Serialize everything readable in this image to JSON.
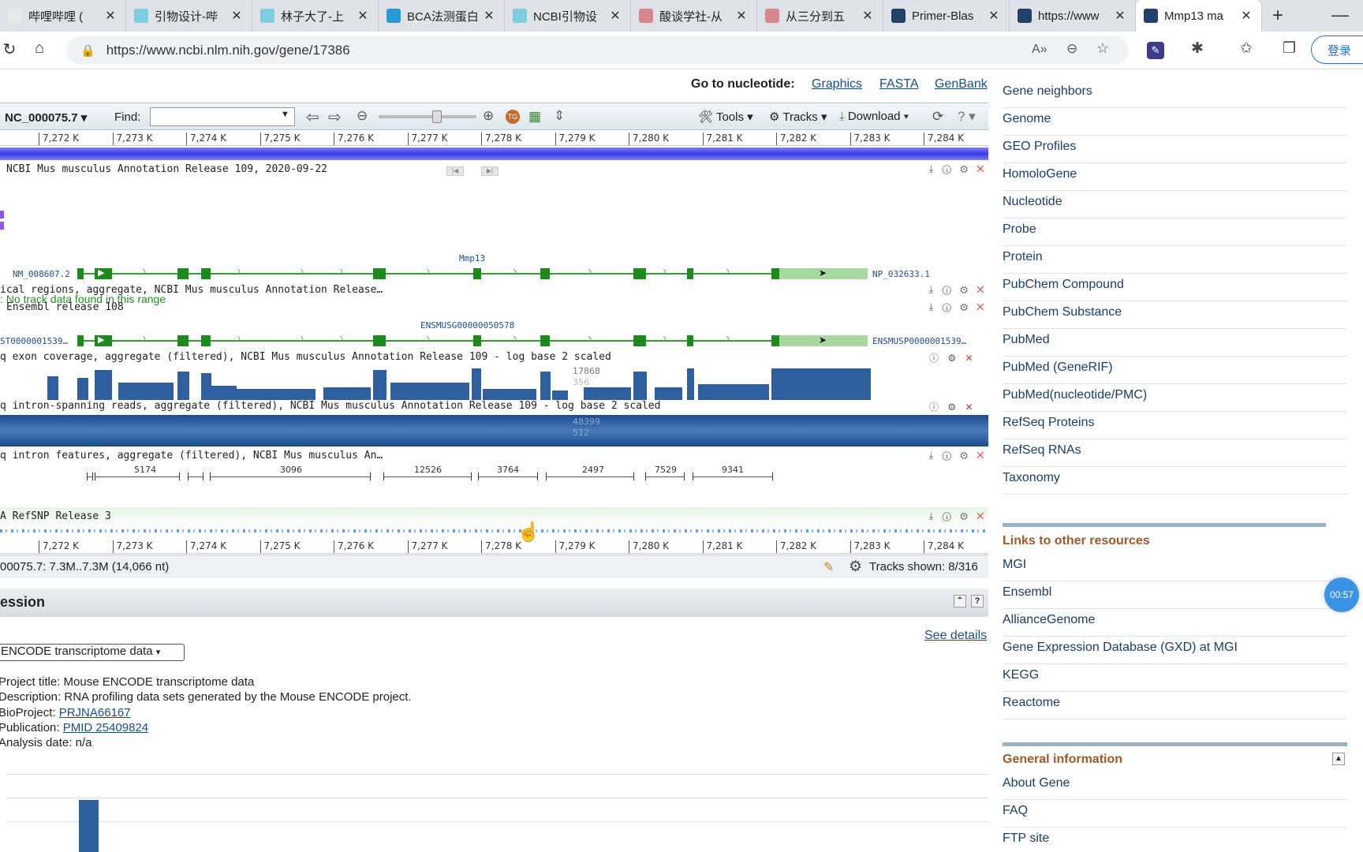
{
  "browser": {
    "tabs": [
      {
        "title": "哔哩哔哩 (",
        "color": "#e8e8e8"
      },
      {
        "title": "引物设计-哔",
        "color": "#7fcde0"
      },
      {
        "title": "林子大了-上",
        "color": "#7fcde0"
      },
      {
        "title": "BCA法测蛋白",
        "color": "#2a9ad6"
      },
      {
        "title": "NCBI引物设",
        "color": "#7fcde0"
      },
      {
        "title": "酸谈学社-从",
        "color": "#d9868e"
      },
      {
        "title": "从三分到五",
        "color": "#d9868e"
      },
      {
        "title": "Primer-Blas",
        "color": "#23406a"
      },
      {
        "title": "https://www",
        "color": "#23406a"
      },
      {
        "title": "Mmp13 ma",
        "color": "#23406a"
      }
    ],
    "url": "https://www.ncbi.nlm.nih.gov/gene/17386",
    "login_label": "登录"
  },
  "goto": {
    "label": "Go to nucleotide:",
    "links": [
      "Graphics",
      "FASTA",
      "GenBank"
    ]
  },
  "viewer": {
    "accession": "NC_000075.7 ▾",
    "find_label": "Find:",
    "tools_label": "Tools ▾",
    "tracks_label": "Tracks ▾",
    "download_label": "Download ▾",
    "ruler_ticks": [
      "7,272 K",
      "7,273 K",
      "7,274 K",
      "7,275 K",
      "7,276 K",
      "7,277 K",
      "7,278 K",
      "7,279 K",
      "7,280 K",
      "7,281 K",
      "7,282 K",
      "7,283 K",
      "7,284 K"
    ],
    "tracks": [
      "NCBI Mus musculus Annotation Release 109, 2020-09-22",
      "ical regions, aggregate, NCBI Mus musculus Annotation Release…",
      "Ensembl release 108",
      "q exon coverage, aggregate (filtered), NCBI Mus musculus Annotation Release 109 - log base 2 scaled",
      "q intron-spanning reads, aggregate (filtered), NCBI Mus musculus Annotation Release 109 - log base 2 scaled",
      "q intron features, aggregate (filtered), NCBI Mus musculus An…",
      "A RefSNP Release 3"
    ],
    "no_data_text": ": No track data found in this range",
    "gene_name": "Mmp13",
    "transcript_left": "NM_008607.2",
    "protein_right": "NP_032633.1",
    "ensembl_gene": "ENSMUSG00000050578",
    "ensembl_left": "ST0000001539…",
    "ensembl_right": "ENSMUSP0000001539…",
    "coverage_labels": [
      "17868",
      "356"
    ],
    "intron_span_labels": [
      "48399",
      "512"
    ],
    "intron_features": [
      "5174",
      "3096",
      "12526",
      "3764",
      "2497",
      "7529",
      "9341"
    ],
    "status_left": "00075.7: 7.3M..7.3M (14,066 nt)",
    "status_right": "Tracks shown: 8/316"
  },
  "expression": {
    "header": "ession",
    "see_details": "See details",
    "project_select": "ENCODE transcriptome data",
    "project_title_label": "Project title: ",
    "project_title": "Mouse ENCODE transcriptome data",
    "description_label": "Description: ",
    "description": "RNA profiling data sets generated by the Mouse ENCODE project.",
    "bioproject_label": "BioProject: ",
    "bioproject": "PRJNA66167",
    "publication_label": "Publication: ",
    "publication": "PMID 25409824",
    "analysis_label": "Analysis date: ",
    "analysis_date": "n/a"
  },
  "sidebar": {
    "related": [
      "Gene neighbors",
      "Genome",
      "GEO Profiles",
      "HomoloGene",
      "Nucleotide",
      "Probe",
      "Protein",
      "PubChem Compound",
      "PubChem Substance",
      "PubMed",
      "PubMed (GeneRIF)",
      "PubMed(nucleotide/PMC)",
      "RefSeq Proteins",
      "RefSeq RNAs",
      "Taxonomy"
    ],
    "other_resources_title": "Links to other resources",
    "other_resources": [
      "MGI",
      "Ensembl",
      "AllianceGenome",
      "Gene Expression Database (GXD) at MGI",
      "KEGG",
      "Reactome"
    ],
    "general_title": "General information",
    "general": [
      "About Gene",
      "FAQ",
      "FTP site"
    ]
  },
  "timer": "00:57"
}
